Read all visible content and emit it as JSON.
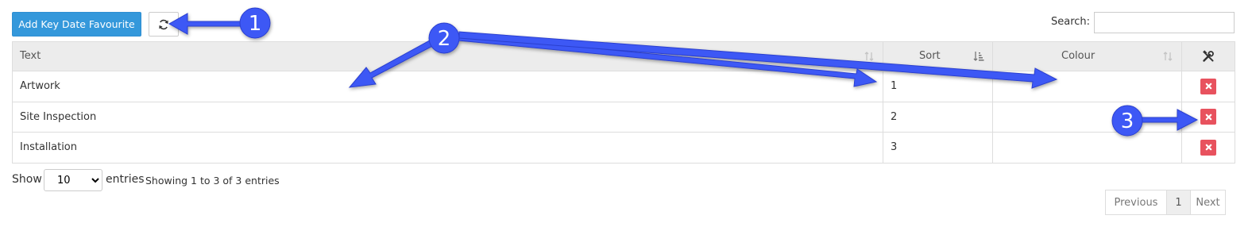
{
  "toolbar": {
    "add_label": "Add Key Date Favourite",
    "refresh_icon": "refresh-icon"
  },
  "search": {
    "label": "Search:",
    "value": "",
    "placeholder": ""
  },
  "table": {
    "columns": [
      "Text",
      "Sort",
      "Colour"
    ],
    "actions_icon": "tools-icon",
    "rows": [
      {
        "text": "Artwork",
        "sort": "1",
        "colour": ""
      },
      {
        "text": "Site Inspection",
        "sort": "2",
        "colour": ""
      },
      {
        "text": "Installation",
        "sort": "3",
        "colour": ""
      }
    ]
  },
  "footer": {
    "show_label": "Show",
    "page_size": "10",
    "entries_label": "entries",
    "info": "Showing 1 to 3 of 3 entries"
  },
  "pagination": {
    "previous": "Previous",
    "current": "1",
    "next": "Next"
  },
  "annotations": {
    "callout_1": "1",
    "callout_2": "2",
    "callout_3": "3"
  },
  "colors": {
    "primary": "#3498db",
    "danger": "#e8525e",
    "annotation_blue": "#3d59f5",
    "header_bg": "#ececec"
  }
}
